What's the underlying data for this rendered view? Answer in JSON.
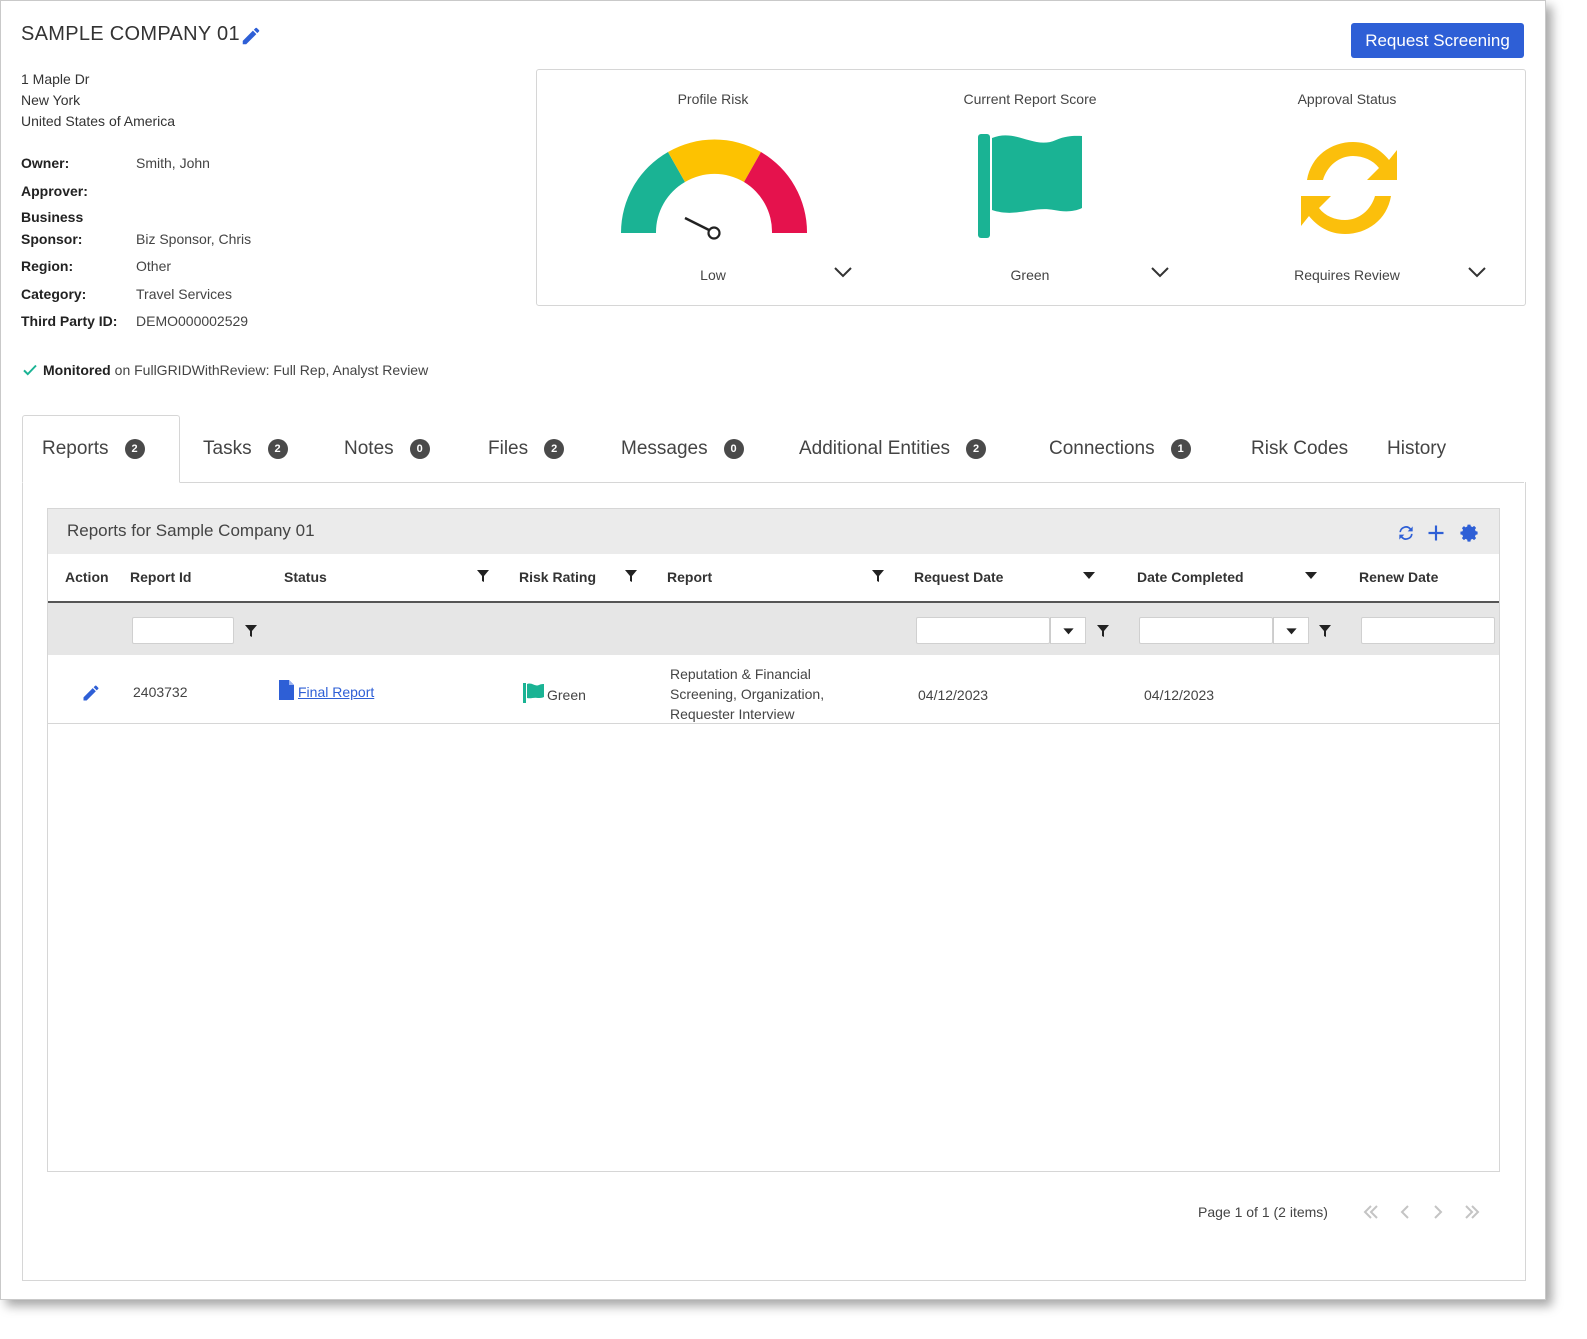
{
  "header": {
    "company_name": "SAMPLE COMPANY 01",
    "request_button": "Request Screening"
  },
  "address": {
    "line1": "1 Maple Dr",
    "line2": "New York",
    "line3": "United States of America"
  },
  "fields": {
    "owner_label": "Owner:",
    "owner_value": "Smith, John",
    "approver_label": "Approver:",
    "approver_value": "",
    "sponsor_label_1": "Business",
    "sponsor_label_2": "Sponsor:",
    "sponsor_value": "Biz Sponsor, Chris",
    "region_label": "Region:",
    "region_value": "Other",
    "category_label": "Category:",
    "category_value": "Travel Services",
    "tpid_label": "Third Party ID:",
    "tpid_value": "DEMO000002529"
  },
  "monitored": {
    "bold": "Monitored",
    "text": "on FullGRIDWithReview: Full Rep, Analyst Review"
  },
  "summary": {
    "profile_risk": {
      "title": "Profile Risk",
      "value": "Low"
    },
    "report_score": {
      "title": "Current Report Score",
      "value": "Green"
    },
    "approval": {
      "title": "Approval Status",
      "value": "Requires Review"
    }
  },
  "colors": {
    "accent": "#2e5fd6",
    "gauge_green": "#1ab394",
    "gauge_yellow": "#fdc201",
    "gauge_red": "#e5124d",
    "flag": "#1ab394",
    "approval_icon": "#fbbf0c"
  },
  "tabs": [
    {
      "label": "Reports",
      "count": "2"
    },
    {
      "label": "Tasks",
      "count": "2"
    },
    {
      "label": "Notes",
      "count": "0"
    },
    {
      "label": "Files",
      "count": "2"
    },
    {
      "label": "Messages",
      "count": "0"
    },
    {
      "label": "Additional Entities",
      "count": "2"
    },
    {
      "label": "Connections",
      "count": "1"
    },
    {
      "label": "Risk Codes"
    },
    {
      "label": "History"
    }
  ],
  "grid": {
    "title": "Reports for Sample Company 01",
    "columns": [
      "Action",
      "Report Id",
      "Status",
      "Risk Rating",
      "Report",
      "Request Date",
      "Date Completed",
      "Renew Date"
    ],
    "rows": [
      {
        "report_id": "2403732",
        "status": "Final Report",
        "risk_rating": "Green",
        "report_line1": "Reputation & Financial",
        "report_line2": "Screening, Organization,",
        "report_line3": "Requester Interview",
        "request_date": "04/12/2023",
        "date_completed": "04/12/2023",
        "renew_date": ""
      }
    ]
  },
  "pager": {
    "text": "Page 1 of 1 (2 items)"
  }
}
